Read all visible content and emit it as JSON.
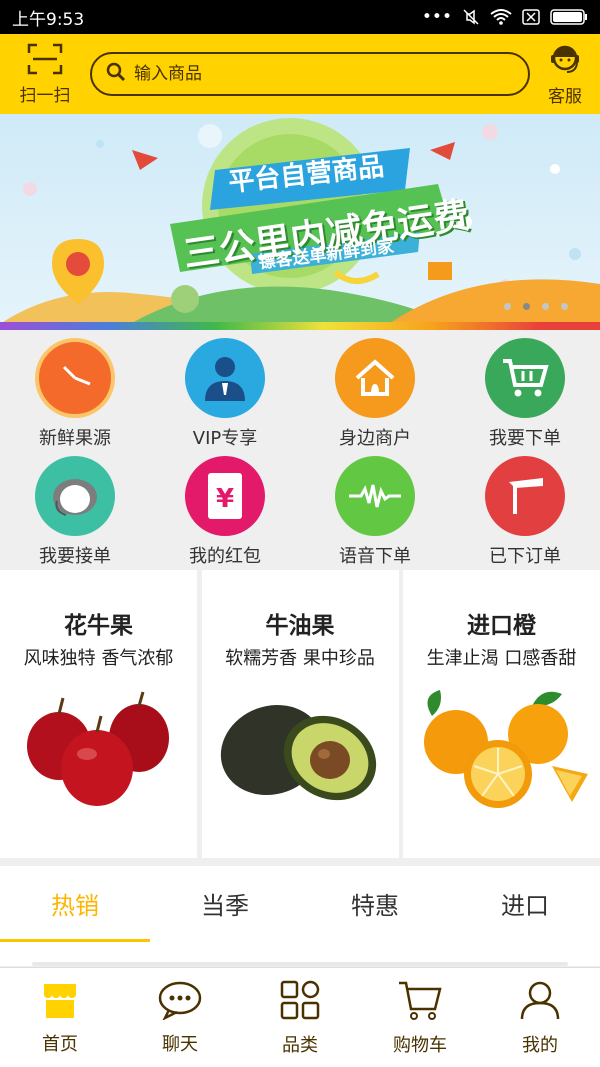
{
  "status_bar": {
    "time": "上午9:53"
  },
  "header": {
    "scan_label": "扫一扫",
    "search_placeholder": "输入商品",
    "service_label": "客服"
  },
  "banner": {
    "line1": "平台自营商品",
    "line2": "三公里内减免运费",
    "line3": "镖客送单新鲜到家",
    "dot_count": 4,
    "active_dot": 1
  },
  "quick_menu": [
    {
      "label": "新鲜果源",
      "icon": "clock-icon",
      "color": "#f46a2a"
    },
    {
      "label": "VIP专享",
      "icon": "vip-person-icon",
      "color": "#2aa8e0"
    },
    {
      "label": "身边商户",
      "icon": "house-icon",
      "color": "#f59a1c"
    },
    {
      "label": "我要下单",
      "icon": "cart-icon",
      "color": "#3aa85a"
    },
    {
      "label": "我要接单",
      "icon": "courier-icon",
      "color": "#3dbfa4"
    },
    {
      "label": "我的红包",
      "icon": "red-packet-icon",
      "color": "#e31a6a"
    },
    {
      "label": "语音下单",
      "icon": "voice-wave-icon",
      "color": "#62c743"
    },
    {
      "label": "已下订单",
      "icon": "hammer-icon",
      "color": "#e24040"
    }
  ],
  "products": [
    {
      "name": "花牛果",
      "desc": "风味独特 香气浓郁",
      "image": "red-apples"
    },
    {
      "name": "牛油果",
      "desc": "软糯芳香 果中珍品",
      "image": "avocados"
    },
    {
      "name": "进口橙",
      "desc": "生津止渴 口感香甜",
      "image": "oranges"
    }
  ],
  "tabs": [
    {
      "label": "热销",
      "active": true
    },
    {
      "label": "当季",
      "active": false
    },
    {
      "label": "特惠",
      "active": false
    },
    {
      "label": "进口",
      "active": false
    }
  ],
  "bottom_nav": [
    {
      "label": "首页",
      "icon": "home-store-icon",
      "active": true
    },
    {
      "label": "聊天",
      "icon": "chat-bubble-icon",
      "active": false
    },
    {
      "label": "品类",
      "icon": "category-grid-icon",
      "active": false
    },
    {
      "label": "购物车",
      "icon": "shopping-cart-icon",
      "active": false
    },
    {
      "label": "我的",
      "icon": "user-icon",
      "active": false
    }
  ],
  "colors": {
    "brand_yellow": "#ffd200",
    "brand_brown": "#4a3200",
    "active_tab": "#ffb400"
  }
}
